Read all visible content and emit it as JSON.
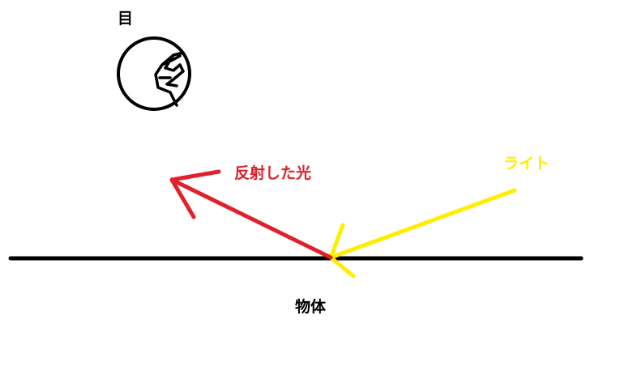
{
  "labels": {
    "eye": "目",
    "reflected_light": "反射した光",
    "light": "ライト",
    "object": "物体"
  },
  "colors": {
    "line": "#000000",
    "reflected": "#e0202b",
    "light": "#ffee00",
    "text_dark": "#000000"
  },
  "icons": {
    "eye": "eye-icon"
  }
}
